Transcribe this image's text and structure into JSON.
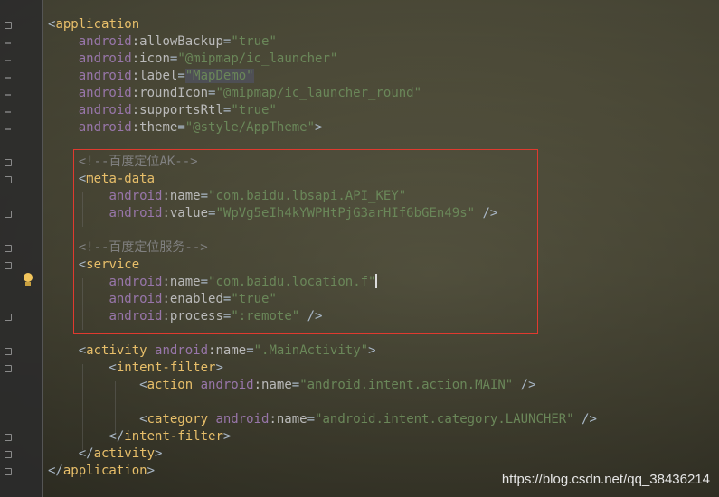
{
  "editor": {
    "lines": [
      {
        "parts": [
          {
            "c": "p",
            "t": "<"
          },
          {
            "c": "t",
            "t": "application"
          }
        ]
      },
      {
        "parts": [
          {
            "c": "p",
            "t": "    "
          },
          {
            "c": "ns",
            "t": "android"
          },
          {
            "c": "at",
            "t": ":allowBackup"
          },
          {
            "c": "p",
            "t": "="
          },
          {
            "c": "v",
            "t": "\"true\""
          }
        ]
      },
      {
        "parts": [
          {
            "c": "p",
            "t": "    "
          },
          {
            "c": "ns",
            "t": "android"
          },
          {
            "c": "at",
            "t": ":icon"
          },
          {
            "c": "p",
            "t": "="
          },
          {
            "c": "v",
            "t": "\"@mipmap/ic_launcher\""
          }
        ]
      },
      {
        "parts": [
          {
            "c": "p",
            "t": "    "
          },
          {
            "c": "ns",
            "t": "android"
          },
          {
            "c": "at",
            "t": ":label"
          },
          {
            "c": "p",
            "t": "="
          },
          {
            "c": "v hl",
            "t": "\"MapDemo\""
          }
        ]
      },
      {
        "parts": [
          {
            "c": "p",
            "t": "    "
          },
          {
            "c": "ns",
            "t": "android"
          },
          {
            "c": "at",
            "t": ":roundIcon"
          },
          {
            "c": "p",
            "t": "="
          },
          {
            "c": "v",
            "t": "\"@mipmap/ic_launcher_round\""
          }
        ]
      },
      {
        "parts": [
          {
            "c": "p",
            "t": "    "
          },
          {
            "c": "ns",
            "t": "android"
          },
          {
            "c": "at",
            "t": ":supportsRtl"
          },
          {
            "c": "p",
            "t": "="
          },
          {
            "c": "v",
            "t": "\"true\""
          }
        ]
      },
      {
        "parts": [
          {
            "c": "p",
            "t": "    "
          },
          {
            "c": "ns",
            "t": "android"
          },
          {
            "c": "at",
            "t": ":theme"
          },
          {
            "c": "p",
            "t": "="
          },
          {
            "c": "v",
            "t": "\"@style/AppTheme\""
          },
          {
            "c": "p",
            "t": ">"
          }
        ]
      },
      {
        "parts": []
      },
      {
        "parts": [
          {
            "c": "p",
            "t": "    "
          },
          {
            "c": "c",
            "t": "<!--百度定位AK-->"
          }
        ]
      },
      {
        "parts": [
          {
            "c": "p",
            "t": "    <"
          },
          {
            "c": "t",
            "t": "meta-data"
          }
        ]
      },
      {
        "parts": [
          {
            "c": "p",
            "t": "        "
          },
          {
            "c": "ns",
            "t": "android"
          },
          {
            "c": "at",
            "t": ":name"
          },
          {
            "c": "p",
            "t": "="
          },
          {
            "c": "v",
            "t": "\"com.baidu.lbsapi.API_KEY\""
          }
        ]
      },
      {
        "parts": [
          {
            "c": "p",
            "t": "        "
          },
          {
            "c": "ns",
            "t": "android"
          },
          {
            "c": "at",
            "t": ":value"
          },
          {
            "c": "p",
            "t": "="
          },
          {
            "c": "v",
            "t": "\"WpVg5eIh4kYWPHtPjG3arHIf6bGEn49s\""
          },
          {
            "c": "p",
            "t": " />"
          }
        ]
      },
      {
        "parts": []
      },
      {
        "parts": [
          {
            "c": "p",
            "t": "    "
          },
          {
            "c": "c",
            "t": "<!--百度定位服务-->"
          }
        ]
      },
      {
        "parts": [
          {
            "c": "p",
            "t": "    <"
          },
          {
            "c": "t",
            "t": "service"
          }
        ]
      },
      {
        "parts": [
          {
            "c": "p",
            "t": "        "
          },
          {
            "c": "ns",
            "t": "android"
          },
          {
            "c": "at",
            "t": ":name"
          },
          {
            "c": "p",
            "t": "="
          },
          {
            "c": "v",
            "t": "\"com.baidu.location.f\""
          }
        ],
        "caret": true
      },
      {
        "parts": [
          {
            "c": "p",
            "t": "        "
          },
          {
            "c": "ns",
            "t": "android"
          },
          {
            "c": "at",
            "t": ":enabled"
          },
          {
            "c": "p",
            "t": "="
          },
          {
            "c": "v",
            "t": "\"true\""
          }
        ]
      },
      {
        "parts": [
          {
            "c": "p",
            "t": "        "
          },
          {
            "c": "ns",
            "t": "android"
          },
          {
            "c": "at",
            "t": ":process"
          },
          {
            "c": "p",
            "t": "="
          },
          {
            "c": "v",
            "t": "\":remote\""
          },
          {
            "c": "p",
            "t": " />"
          }
        ]
      },
      {
        "parts": []
      },
      {
        "parts": [
          {
            "c": "p",
            "t": "    <"
          },
          {
            "c": "t",
            "t": "activity "
          },
          {
            "c": "ns",
            "t": "android"
          },
          {
            "c": "at",
            "t": ":name"
          },
          {
            "c": "p",
            "t": "="
          },
          {
            "c": "v",
            "t": "\".MainActivity\""
          },
          {
            "c": "p",
            "t": ">"
          }
        ]
      },
      {
        "parts": [
          {
            "c": "p",
            "t": "        <"
          },
          {
            "c": "t",
            "t": "intent-filter"
          },
          {
            "c": "p",
            "t": ">"
          }
        ]
      },
      {
        "parts": [
          {
            "c": "p",
            "t": "            <"
          },
          {
            "c": "t",
            "t": "action "
          },
          {
            "c": "ns",
            "t": "android"
          },
          {
            "c": "at",
            "t": ":name"
          },
          {
            "c": "p",
            "t": "="
          },
          {
            "c": "v",
            "t": "\"android.intent.action.MAIN\""
          },
          {
            "c": "p",
            "t": " />"
          }
        ]
      },
      {
        "parts": []
      },
      {
        "parts": [
          {
            "c": "p",
            "t": "            <"
          },
          {
            "c": "t",
            "t": "category "
          },
          {
            "c": "ns",
            "t": "android"
          },
          {
            "c": "at",
            "t": ":name"
          },
          {
            "c": "p",
            "t": "="
          },
          {
            "c": "v",
            "t": "\"android.intent.category.LAUNCHER\""
          },
          {
            "c": "p",
            "t": " />"
          }
        ]
      },
      {
        "parts": [
          {
            "c": "p",
            "t": "        </"
          },
          {
            "c": "t",
            "t": "intent-filter"
          },
          {
            "c": "p",
            "t": ">"
          }
        ]
      },
      {
        "parts": [
          {
            "c": "p",
            "t": "    </"
          },
          {
            "c": "t",
            "t": "activity"
          },
          {
            "c": "p",
            "t": ">"
          }
        ]
      },
      {
        "parts": [
          {
            "c": "p",
            "t": "</"
          },
          {
            "c": "t",
            "t": "application"
          },
          {
            "c": "p",
            "t": ">"
          }
        ]
      }
    ]
  },
  "gutter": {
    "lightbulb_icon": "intention-bulb-icon"
  },
  "watermark": "https://blog.csdn.net/qq_38436214",
  "colors": {
    "tag": "#e8bf6a",
    "namespace": "#9876aa",
    "attribute": "#bababa",
    "value": "#6a8759",
    "comment": "#808080",
    "selection_box": "#e03a2f"
  }
}
